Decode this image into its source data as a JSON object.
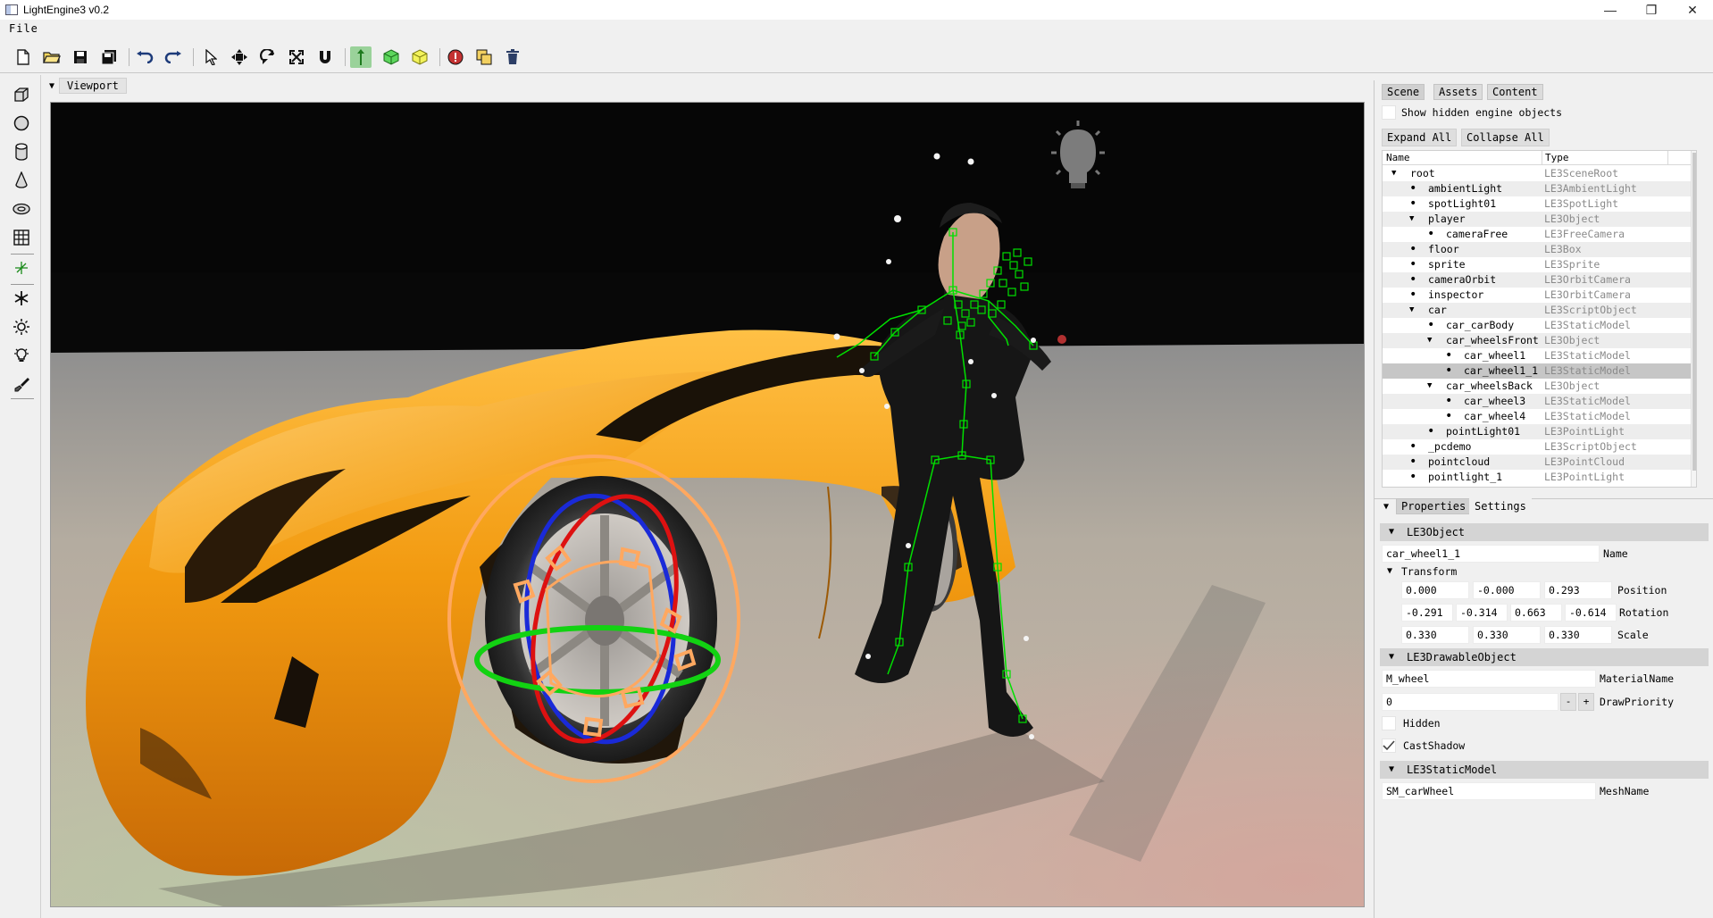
{
  "window": {
    "title": "LightEngine3 v0.2",
    "minimize": "—",
    "maximize": "❐",
    "close": "✕"
  },
  "menu": {
    "file": "File"
  },
  "viewport": {
    "label": "Viewport"
  },
  "scene_panel": {
    "tabs": [
      "Scene",
      "Assets",
      "Content"
    ],
    "show_hidden_label": "Show hidden engine objects",
    "expand_all": "Expand All",
    "collapse_all": "Collapse All",
    "columns": {
      "name": "Name",
      "type": "Type"
    },
    "rows": [
      {
        "name": "root",
        "type": "LE3SceneRoot",
        "depth": 0,
        "marker": "▼"
      },
      {
        "name": "ambientLight",
        "type": "LE3AmbientLight",
        "depth": 1,
        "marker": "•"
      },
      {
        "name": "spotLight01",
        "type": "LE3SpotLight",
        "depth": 1,
        "marker": "•"
      },
      {
        "name": "player",
        "type": "LE3Object",
        "depth": 1,
        "marker": "▼"
      },
      {
        "name": "cameraFree",
        "type": "LE3FreeCamera",
        "depth": 2,
        "marker": "•"
      },
      {
        "name": "floor",
        "type": "LE3Box",
        "depth": 1,
        "marker": "•"
      },
      {
        "name": "sprite",
        "type": "LE3Sprite",
        "depth": 1,
        "marker": "•"
      },
      {
        "name": "cameraOrbit",
        "type": "LE3OrbitCamera",
        "depth": 1,
        "marker": "•"
      },
      {
        "name": "inspector",
        "type": "LE3OrbitCamera",
        "depth": 1,
        "marker": "•"
      },
      {
        "name": "car",
        "type": "LE3ScriptObject",
        "depth": 1,
        "marker": "▼"
      },
      {
        "name": "car_carBody",
        "type": "LE3StaticModel",
        "depth": 2,
        "marker": "•"
      },
      {
        "name": "car_wheelsFront",
        "type": "LE3Object",
        "depth": 2,
        "marker": "▼"
      },
      {
        "name": "car_wheel1",
        "type": "LE3StaticModel",
        "depth": 3,
        "marker": "•"
      },
      {
        "name": "car_wheel1_1",
        "type": "LE3StaticModel",
        "depth": 3,
        "marker": "•",
        "selected": true
      },
      {
        "name": "car_wheelsBack",
        "type": "LE3Object",
        "depth": 2,
        "marker": "▼"
      },
      {
        "name": "car_wheel3",
        "type": "LE3StaticModel",
        "depth": 3,
        "marker": "•"
      },
      {
        "name": "car_wheel4",
        "type": "LE3StaticModel",
        "depth": 3,
        "marker": "•"
      },
      {
        "name": "pointLight01",
        "type": "LE3PointLight",
        "depth": 2,
        "marker": "•"
      },
      {
        "name": "_pcdemo",
        "type": "LE3ScriptObject",
        "depth": 1,
        "marker": "•"
      },
      {
        "name": "pointcloud",
        "type": "LE3PointCloud",
        "depth": 1,
        "marker": "•"
      },
      {
        "name": "pointlight_1",
        "type": "LE3PointLight",
        "depth": 1,
        "marker": "•"
      }
    ]
  },
  "properties_panel": {
    "tabs": [
      "Properties",
      "Settings"
    ],
    "sections": {
      "object": "LE3Object",
      "drawable": "LE3DrawableObject",
      "static_model": "LE3StaticModel"
    },
    "name_value": "car_wheel1_1",
    "name_label": "Name",
    "transform_label": "Transform",
    "position": [
      "0.000",
      "-0.000",
      "0.293"
    ],
    "position_label": "Position",
    "rotation": [
      "-0.291",
      "-0.314",
      "0.663",
      "-0.614"
    ],
    "rotation_label": "Rotation",
    "scale": [
      "0.330",
      "0.330",
      "0.330"
    ],
    "scale_label": "Scale",
    "material_value": "M_wheel",
    "material_label": "MaterialName",
    "draw_priority_value": "0",
    "draw_priority_label": "DrawPriority",
    "minus": "-",
    "plus": "+",
    "hidden_label": "Hidden",
    "hidden_checked": false,
    "cast_shadow_label": "CastShadow",
    "cast_shadow_checked": true,
    "mesh_value": "SM_carWheel",
    "mesh_label": "MeshName"
  },
  "icons": {
    "toolbar": [
      "new-file-icon",
      "open-folder-icon",
      "save-icon",
      "save-all-icon",
      "undo-icon",
      "redo-icon",
      "select-pointer-icon",
      "move-icon",
      "rotate-icon",
      "scale-icon",
      "magnet-icon",
      "gizmo-local-icon",
      "add-cube-icon",
      "add-model-icon",
      "stop-icon",
      "duplicate-icon",
      "delete-icon"
    ],
    "left": [
      "box-icon",
      "sphere-icon",
      "cylinder-icon",
      "cone-icon",
      "torus-icon",
      "grid-icon",
      "axis-icon",
      "snowflake-icon",
      "sun-icon",
      "bulb-icon",
      "brush-icon"
    ]
  },
  "colors": {
    "accent_green": "#00e000",
    "car_orange": "#f09a10",
    "gizmo_red": "#dd1111",
    "gizmo_blue": "#1a2ad8",
    "gizmo_orange": "#ffa860"
  }
}
